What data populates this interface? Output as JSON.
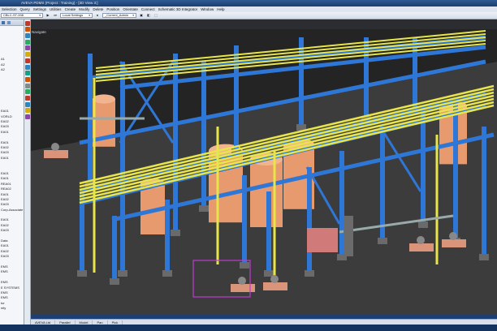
{
  "window": {
    "title": "AVEVA PDMS (Project : Training) - [3D View 3:]"
  },
  "menu": [
    "Selection",
    "Query",
    "Settings",
    "Utilities",
    "Create",
    "Modify",
    "Delete",
    "Position",
    "Orientate",
    "Connect",
    "Schematic 3D Integrator",
    "Window",
    "Help"
  ],
  "toolbar": {
    "element_combo": "CBLC-ST-008",
    "settings_combo": "Local Settings",
    "admin_combo": "_Current_Admin"
  },
  "tree": {
    "items": [
      "",
      "",
      "",
      "",
      "",
      "",
      "",
      "",
      "",
      "",
      "",
      "",
      "",
      "",
      "",
      "",
      "",
      "",
      "",
      "",
      "",
      "",
      "",
      "",
      "",
      "",
      "",
      "",
      "",
      "",
      "",
      "",
      "",
      "",
      "",
      "",
      "",
      "",
      "",
      "",
      "",
      "",
      "",
      "",
      "",
      "",
      "",
      "",
      "",
      "",
      "",
      "",
      "",
      "",
      ""
    ]
  },
  "tree_visible": [
    {
      "row": 6,
      "text": "A1"
    },
    {
      "row": 7,
      "text": "A2"
    },
    {
      "row": 8,
      "text": "A2"
    },
    {
      "row": 16,
      "text": "EA01"
    },
    {
      "row": 17,
      "text": "VORLD"
    },
    {
      "row": 18,
      "text": "EA02"
    },
    {
      "row": 19,
      "text": "EA03"
    },
    {
      "row": 20,
      "text": "EA01"
    },
    {
      "row": 22,
      "text": "EA01"
    },
    {
      "row": 23,
      "text": "EA02"
    },
    {
      "row": 24,
      "text": "EA03"
    },
    {
      "row": 25,
      "text": "EA01"
    },
    {
      "row": 28,
      "text": "EA01"
    },
    {
      "row": 29,
      "text": "EA01"
    },
    {
      "row": 30,
      "text": "REA01"
    },
    {
      "row": 31,
      "text": "REA02"
    },
    {
      "row": 32,
      "text": "EA01"
    },
    {
      "row": 33,
      "text": "EA02"
    },
    {
      "row": 34,
      "text": "EA03"
    },
    {
      "row": 35,
      "text": "Corp-Associate"
    },
    {
      "row": 37,
      "text": "EA01"
    },
    {
      "row": 38,
      "text": "EA02"
    },
    {
      "row": 39,
      "text": "EA03"
    },
    {
      "row": 41,
      "text": "Data"
    },
    {
      "row": 42,
      "text": "EA01"
    },
    {
      "row": 43,
      "text": "EA02"
    },
    {
      "row": 44,
      "text": "EA03"
    },
    {
      "row": 46,
      "text": "EMS"
    },
    {
      "row": 47,
      "text": "EMS"
    },
    {
      "row": 49,
      "text": "EMS"
    },
    {
      "row": 50,
      "text": "E SYSTEMS"
    },
    {
      "row": 51,
      "text": "EMS"
    },
    {
      "row": 52,
      "text": "EMS"
    },
    {
      "row": 53,
      "text": "tor"
    },
    {
      "row": 54,
      "text": "nity"
    }
  ],
  "viewport": {
    "label": "Navigate"
  },
  "status": [
    "AVEVA Ltd",
    "Parallel",
    "Model",
    "Pan",
    "Pick"
  ],
  "colors": {
    "steel": "#2f77d6",
    "pipe": "#e8e54a",
    "vessel": "#e69a6e",
    "floor": "#3c3c3c",
    "highlight": "#c03ad0"
  },
  "icons": [
    "search-icon",
    "select-icon",
    "zoom-icon",
    "rotate-icon",
    "pan-icon",
    "walk-icon",
    "clip-icon",
    "measure-icon"
  ]
}
